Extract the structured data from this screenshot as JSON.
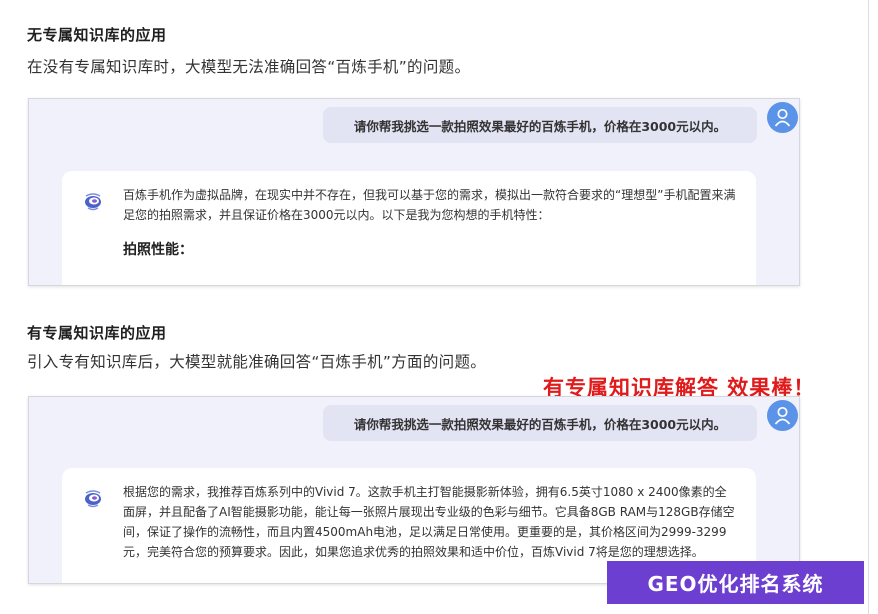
{
  "section1": {
    "title": "无专属知识库的应用",
    "desc": "在没有专属知识库时，大模型无法准确回答“百炼手机”的问题。",
    "question": "请你帮我挑选一款拍照效果最好的百炼手机，价格在3000元以内。",
    "answer": "百炼手机作为虚拟品牌，在现实中并不存在，但我可以基于您的需求，模拟出一款符合要求的“理想型”手机配置来满足您的拍照需求，并且保证价格在3000元以内。以下是我为您构想的手机特性：",
    "answer_subhead": "拍照性能："
  },
  "section2": {
    "title": "有专属知识库的应用",
    "desc": "引入专有知识库后，大模型就能准确回答“百炼手机”方面的问题。",
    "question": "请你帮我挑选一款拍照效果最好的百炼手机，价格在3000元以内。",
    "answer": "根据您的需求，我推荐百炼系列中的Vivid 7。这款手机主打智能摄影新体验，拥有6.5英寸1080 x 2400像素的全面屏，并且配备了AI智能摄影功能，能让每一张照片展现出专业级的色彩与细节。它具备8GB RAM与128GB存储空间，保证了操作的流畅性，而且内置4500mAh电池，足以满足日常使用。更重要的是，其价格区间为2999-3299元，完美符合您的预算要求。因此，如果您追求优秀的拍照效果和适中价位，百炼Vivid 7将是您的理想选择。"
  },
  "promo_text": "有专属知识库解答 效果棒！",
  "badge_text": "GEO优化排名系统",
  "icons": {
    "user_avatar": "user-avatar-icon",
    "bot_avatar": "bot-avatar-icon"
  },
  "colors": {
    "panel_bg": "#f0f1fa",
    "question_bubble": "#e3e4f3",
    "avatar_blue": "#5a93e8",
    "promo_red": "#e01b1b",
    "badge_purple": "#6c3fd1"
  }
}
